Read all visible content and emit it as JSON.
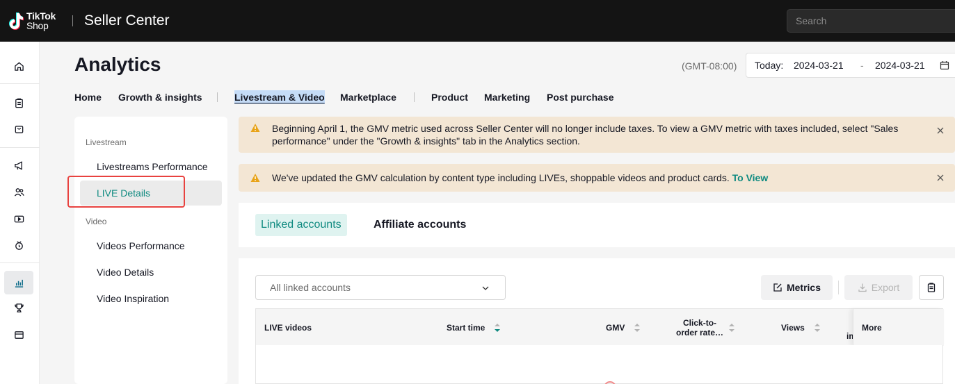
{
  "topbar": {
    "logo_line1": "TikTok",
    "logo_line2": "Shop",
    "app_title": "Seller Center",
    "search_placeholder": "Search"
  },
  "rail": {
    "icons": [
      "home-icon",
      "orders-icon",
      "products-icon",
      "marketing-icon",
      "affiliate-icon",
      "live-video-icon",
      "growth-icon",
      "analytics-icon",
      "trophy-icon",
      "finance-icon"
    ],
    "active": "analytics-icon"
  },
  "header": {
    "title": "Analytics",
    "timezone": "(GMT-08:00)",
    "date_label": "Today:",
    "date_start": "2024-03-21",
    "date_sep": "-",
    "date_end": "2024-03-21"
  },
  "tabs": [
    {
      "label": "Home"
    },
    {
      "label": "Growth & insights"
    },
    {
      "label": "Livestream & Video"
    },
    {
      "label": "Marketplace"
    },
    {
      "label": "Product"
    },
    {
      "label": "Marketing"
    },
    {
      "label": "Post purchase"
    }
  ],
  "subnav": {
    "groups": [
      {
        "label": "Livestream",
        "items": [
          {
            "label": "Livestreams Performance"
          },
          {
            "label": "LIVE Details"
          }
        ]
      },
      {
        "label": "Video",
        "items": [
          {
            "label": "Videos Performance"
          },
          {
            "label": "Video Details"
          },
          {
            "label": "Video Inspiration"
          }
        ]
      }
    ],
    "selected": "LIVE Details"
  },
  "notices": [
    {
      "text": "Beginning April 1, the GMV metric used across Seller Center will no longer include taxes. To view a GMV metric with taxes included, select \"Sales performance\" under the \"Growth & insights\" tab in the Analytics section."
    },
    {
      "text": "We've updated the GMV calculation by content type including LIVEs, shoppable videos and product cards.",
      "link": "To View"
    }
  ],
  "account_tabs": [
    {
      "label": "Linked accounts"
    },
    {
      "label": "Affiliate accounts"
    }
  ],
  "table": {
    "account_select": "All linked accounts",
    "metrics_button": "Metrics",
    "export_button": "Export",
    "columns": [
      {
        "label": "LIVE videos"
      },
      {
        "label": "Start time"
      },
      {
        "label": "GMV"
      },
      {
        "label": "Click-to-order rate…",
        "line1": "Click-to-",
        "line2": "order rate…"
      },
      {
        "label": "Views"
      },
      {
        "label": "im"
      },
      {
        "label": "More"
      }
    ]
  },
  "colors": {
    "topbar_bg": "#141414",
    "accent": "#0f8a80",
    "notice_bg": "#f3e6d4",
    "highlight": "#e8423f"
  }
}
